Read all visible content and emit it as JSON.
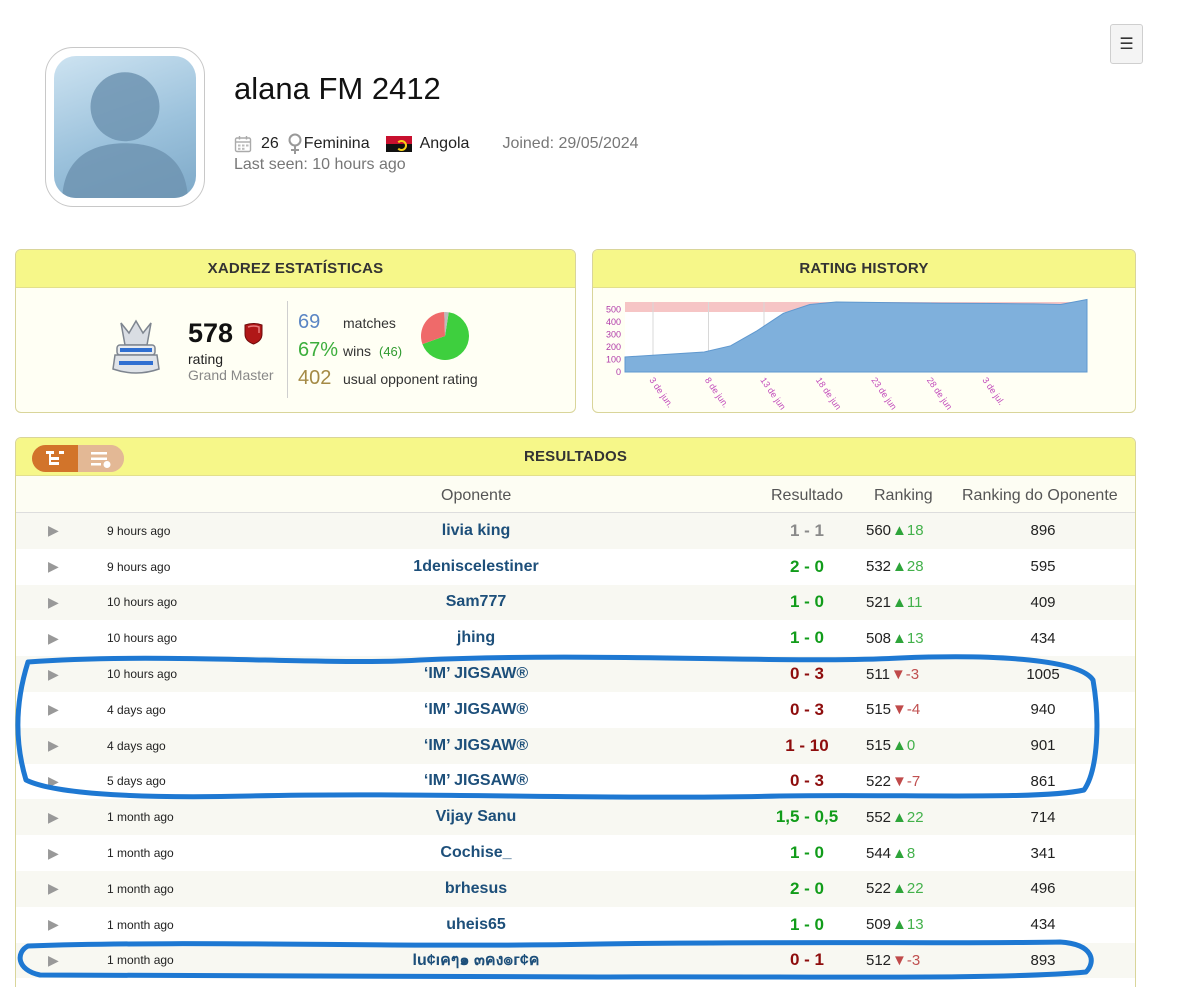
{
  "profile": {
    "name": "alana FM 2412",
    "age": "26",
    "gender": "Feminina",
    "country": "Angola",
    "joined": "Joined: 29/05/2024",
    "last_seen": "Last seen: 10 hours ago"
  },
  "menu": {
    "icon": "☰"
  },
  "stats": {
    "title": "XADREZ ESTATÍSTICAS",
    "rating": "578",
    "rating_word": "rating",
    "rating_title": "Grand Master",
    "matches_value": "69",
    "matches_label": "matches",
    "wins_pct": "67%",
    "wins_label": "wins",
    "wins_count": "(46)",
    "opponent_rating_value": "402",
    "opponent_rating_label": "usual opponent rating",
    "pie_colors": {
      "wins": "#3ecf3e",
      "losses": "#ef6a6a",
      "draws": "#bbbbbb"
    },
    "pie_fractions": {
      "wins": 0.67,
      "losses": 0.3,
      "draws": 0.03
    }
  },
  "history": {
    "title": "RATING HISTORY",
    "chart_data": {
      "type": "area",
      "y_ticks": [
        "500",
        "400",
        "300",
        "200",
        "100",
        "0"
      ],
      "x_ticks": [
        "3 de jun.",
        "8 de jun.",
        "13 de jun.",
        "18 de jun.",
        "23 de jun.",
        "28 de jun.",
        "3 de jul."
      ],
      "ylim": [
        0,
        560
      ],
      "x": [
        0,
        3,
        6,
        8,
        10,
        12,
        14,
        16,
        20,
        24,
        28,
        31,
        33,
        35
      ],
      "values": [
        120,
        140,
        160,
        210,
        330,
        470,
        540,
        560,
        555,
        550,
        548,
        545,
        540,
        580
      ],
      "fill": "#7fb0dc",
      "band_color": "#f6c5c5"
    }
  },
  "results": {
    "title": "RESULTADOS",
    "columns": [
      "Oponente",
      "Resultado",
      "Ranking",
      "Ranking do Oponente"
    ],
    "rows": [
      {
        "time": "9 hours ago",
        "opponent": "livia king",
        "result": "1 - 1",
        "kind": "draw",
        "ranking": "560",
        "dir": "up",
        "delta": "18",
        "opp_rank": "896"
      },
      {
        "time": "9 hours ago",
        "opponent": "1deniscelestiner",
        "result": "2 - 0",
        "kind": "win",
        "ranking": "532",
        "dir": "up",
        "delta": "28",
        "opp_rank": "595"
      },
      {
        "time": "10 hours ago",
        "opponent": "Sam777",
        "result": "1 - 0",
        "kind": "win",
        "ranking": "521",
        "dir": "up",
        "delta": "11",
        "opp_rank": "409"
      },
      {
        "time": "10 hours ago",
        "opponent": "jhing",
        "result": "1 - 0",
        "kind": "win",
        "ranking": "508",
        "dir": "up",
        "delta": "13",
        "opp_rank": "434"
      },
      {
        "time": "10 hours ago",
        "opponent": "‘IM’ JIGSAW®",
        "result": "0 - 3",
        "kind": "loss",
        "ranking": "511",
        "dir": "down",
        "delta": "-3",
        "opp_rank": "1005"
      },
      {
        "time": "4 days ago",
        "opponent": "‘IM’ JIGSAW®",
        "result": "0 - 3",
        "kind": "loss",
        "ranking": "515",
        "dir": "down",
        "delta": "-4",
        "opp_rank": "940"
      },
      {
        "time": "4 days ago",
        "opponent": "‘IM’ JIGSAW®",
        "result": "1 - 10",
        "kind": "loss",
        "ranking": "515",
        "dir": "up",
        "delta": "0",
        "opp_rank": "901"
      },
      {
        "time": "5 days ago",
        "opponent": "‘IM’ JIGSAW®",
        "result": "0 - 3",
        "kind": "loss",
        "ranking": "522",
        "dir": "down",
        "delta": "-7",
        "opp_rank": "861"
      },
      {
        "time": "1 month ago",
        "opponent": "Vijay Sanu",
        "result": "1,5 - 0,5",
        "kind": "win",
        "ranking": "552",
        "dir": "up",
        "delta": "22",
        "opp_rank": "714"
      },
      {
        "time": "1 month ago",
        "opponent": "Cochise_",
        "result": "1 - 0",
        "kind": "win",
        "ranking": "544",
        "dir": "up",
        "delta": "8",
        "opp_rank": "341"
      },
      {
        "time": "1 month ago",
        "opponent": "brhesus",
        "result": "2 - 0",
        "kind": "win",
        "ranking": "522",
        "dir": "up",
        "delta": "22",
        "opp_rank": "496"
      },
      {
        "time": "1 month ago",
        "opponent": "uheis65",
        "result": "1 - 0",
        "kind": "win",
        "ranking": "509",
        "dir": "up",
        "delta": "13",
        "opp_rank": "434"
      },
      {
        "time": "1 month ago",
        "opponent": "lu¢ıคๆ๑ ๓คง๏г¢ค",
        "result": "0 - 1",
        "kind": "loss",
        "ranking": "512",
        "dir": "down",
        "delta": "-3",
        "opp_rank": "893"
      }
    ]
  }
}
